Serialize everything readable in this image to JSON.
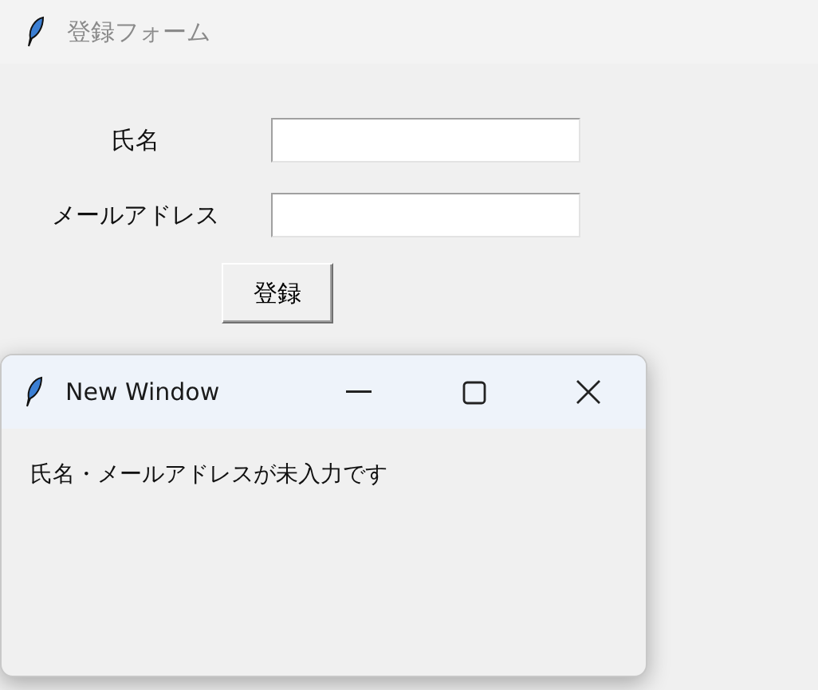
{
  "main_window": {
    "title": "登録フォーム",
    "active": false
  },
  "form": {
    "fields": [
      {
        "label": "氏名"
      },
      {
        "label": "メールアドレス"
      }
    ],
    "submit_button": "登録"
  },
  "dialog": {
    "title": "New Window",
    "message": "氏名・メールアドレスが未入力です"
  }
}
